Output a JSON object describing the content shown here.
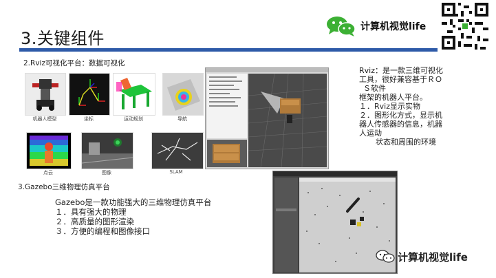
{
  "slide": {
    "title": "3.关键组件"
  },
  "brand": {
    "name": "计算机视觉life",
    "icon": "wechat-icon"
  },
  "section_rviz": {
    "heading": "2.Rviz可视化平台：数据可视化",
    "thumbnails": [
      {
        "caption": "机器人模型"
      },
      {
        "caption": "坐标"
      },
      {
        "caption": "运动规划"
      },
      {
        "caption": "导航"
      },
      {
        "caption": "点云"
      },
      {
        "caption": "图像"
      },
      {
        "caption": "SLAM"
      }
    ],
    "description": {
      "line1": "Rviz：是一款三维可视化",
      "line2": "工具，很好兼容基于ＲＯ",
      "line3": "Ｓ软件",
      "line4": "框架的机器人平台。",
      "line5": "１．Rviz显示实物",
      "line6": "２．图形化方式，显示机",
      "line7": "器人传感器的信息，机器",
      "line8": "人运动",
      "line9": "状态和周围的环境"
    }
  },
  "section_gazebo": {
    "heading": "3.Gazebo三维物理仿真平台",
    "intro": "Gazebo是一款功能强大的三维物理仿真平台",
    "items": [
      "１．具有强大的物理",
      "２．高质量的图形渲染",
      "３．方便的编程和图像接口"
    ]
  },
  "watermark": {
    "text": "计算机视觉life",
    "icon": "wechat-icon"
  },
  "colors": {
    "accent_bar": "#2e5aa8",
    "wechat_green": "#3cb034"
  }
}
